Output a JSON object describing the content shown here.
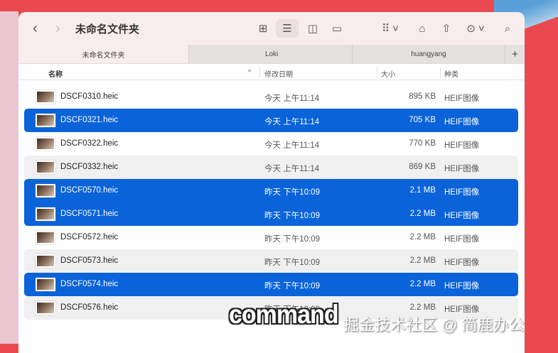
{
  "window": {
    "title": "未命名文件夹"
  },
  "tabs": [
    {
      "label": "未命名文件夹"
    },
    {
      "label": "Loki"
    },
    {
      "label": "huangyang"
    }
  ],
  "toolbar": {
    "back": "‹",
    "forward": "›",
    "new_tab": "+"
  },
  "columns": {
    "name": "名称",
    "date": "修改日期",
    "size": "大小",
    "kind": "种类"
  },
  "files": [
    {
      "name": "DSCF0310.heic",
      "date": "今天 上午11:14",
      "size": "895 KB",
      "kind": "HEIF图像",
      "selected": false
    },
    {
      "name": "DSCF0321.heic",
      "date": "今天 上午11:14",
      "size": "705 KB",
      "kind": "HEIF图像",
      "selected": true
    },
    {
      "name": "DSCF0322.heic",
      "date": "今天 上午11:14",
      "size": "770 KB",
      "kind": "HEIF图像",
      "selected": false
    },
    {
      "name": "DSCF0332.heic",
      "date": "今天 上午11:14",
      "size": "869 KB",
      "kind": "HEIF图像",
      "selected": false
    },
    {
      "name": "DSCF0570.heic",
      "date": "昨天 下午10:09",
      "size": "2.1 MB",
      "kind": "HEIF图像",
      "selected": true
    },
    {
      "name": "DSCF0571.heic",
      "date": "昨天 下午10:09",
      "size": "2.2 MB",
      "kind": "HEIF图像",
      "selected": true
    },
    {
      "name": "DSCF0572.heic",
      "date": "昨天 下午10:09",
      "size": "2.2 MB",
      "kind": "HEIF图像",
      "selected": false
    },
    {
      "name": "DSCF0573.heic",
      "date": "昨天 下午10:09",
      "size": "2.2 MB",
      "kind": "HEIF图像",
      "selected": false
    },
    {
      "name": "DSCF0574.heic",
      "date": "昨天 下午10:09",
      "size": "2.2 MB",
      "kind": "HEIF图像",
      "selected": true
    },
    {
      "name": "DSCF0576.heic",
      "date": "昨天 下午10:09",
      "size": "2.2 MB",
      "kind": "HEIF图像",
      "selected": false
    }
  ],
  "overlay": {
    "caption": "command",
    "watermark": "掘金技术社区 @ 简鹿办公"
  },
  "colors": {
    "selection": "#0a63d8"
  }
}
